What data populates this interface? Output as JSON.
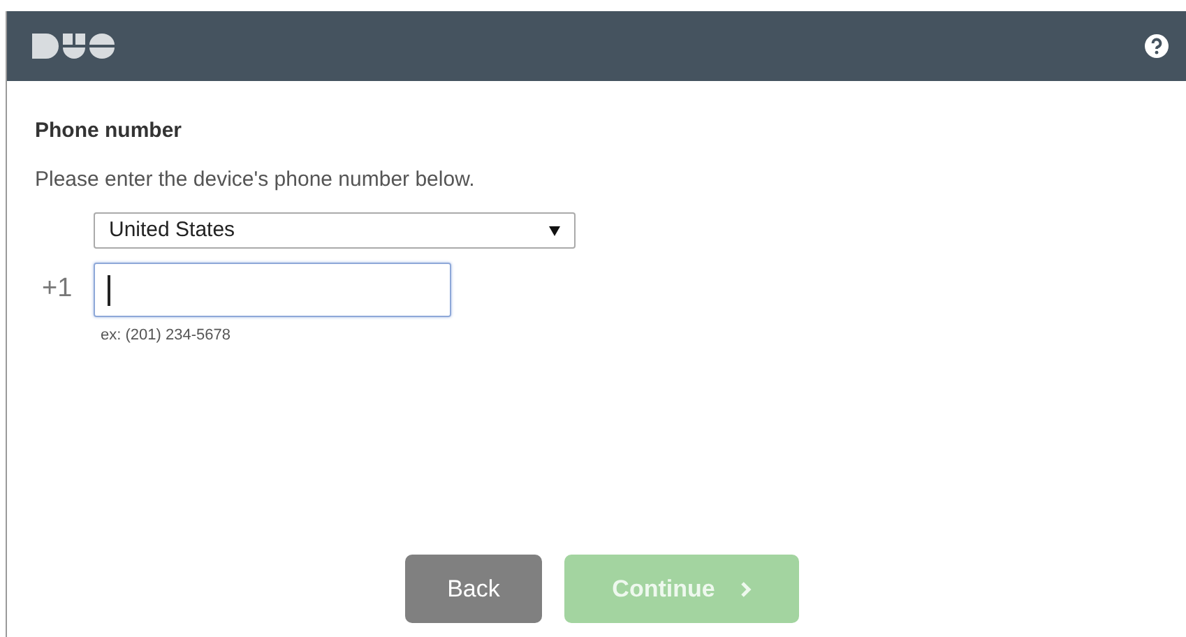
{
  "heading": "Phone number",
  "instruction": "Please enter the device's phone number below.",
  "country_select": {
    "value": "United States"
  },
  "phone": {
    "prefix": "+1",
    "focused": true,
    "hint": "ex: (201) 234-5678"
  },
  "buttons": [
    {
      "kind": "back",
      "label": "Back",
      "disabled": false
    },
    {
      "kind": "continue",
      "label": "Continue",
      "disabled": true
    }
  ]
}
